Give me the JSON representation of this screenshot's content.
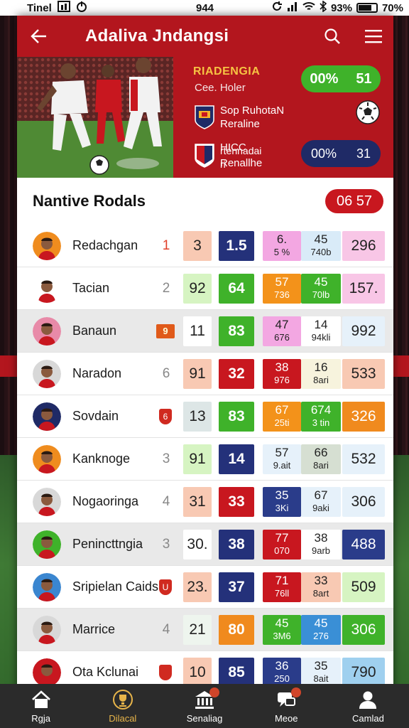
{
  "status_bar": {
    "carrier": "Tinel",
    "time": "944",
    "battery_left": "93%",
    "battery_right": "70%"
  },
  "header": {
    "title": "Adaliva Jndangsi"
  },
  "hero": {
    "label": "RIADENGIA",
    "sub": "Cee. Holer",
    "pill_green": {
      "left": "00%",
      "right": "51"
    },
    "team1": {
      "line1": "Sop RuhotaN",
      "line2": "Reraline"
    },
    "team2": {
      "line1": "HICC",
      "line1b": "rtennadai ri",
      "line2": "Renallhe"
    },
    "pill_navy": {
      "left": "00%",
      "right": "31"
    }
  },
  "section": {
    "title": "Nantive Rodals",
    "score": "06 57"
  },
  "rows": [
    {
      "name": "Redachgan",
      "rank": "1",
      "rank_style": "red",
      "c1": "3",
      "c1_color": "#f8c9b3",
      "c2": "1.5",
      "c2_color": "#24317a",
      "c3_t": "6.",
      "c3_b": "5 %",
      "c3_color": "#f3a7e2",
      "c4_t": "45",
      "c4_b": "740b",
      "c4_color": "#d9ebf8",
      "c5": "296",
      "c5_color": "#f8c6e6",
      "avatar_bg": "#ef8c1e",
      "alt": false
    },
    {
      "name": "Tacian",
      "rank": "2",
      "rank_style": "",
      "c1": "92",
      "c1_color": "#d6f4c2",
      "c2": "64",
      "c2_color": "#3fb22a",
      "c3_t": "57",
      "c3_b": "736",
      "c3_color": "#f3921a",
      "c4_t": "45",
      "c4_b": "70lb",
      "c4_color": "#3fb22a",
      "c5": "157.",
      "c5_color": "#f8c6e6",
      "avatar_bg": "#ffffff",
      "alt": false
    },
    {
      "name": "Banaun",
      "rank": "9",
      "rank_style": "badge",
      "c1": "11",
      "c1_color": "#ffffff",
      "c2": "83",
      "c2_color": "#3fb22a",
      "c3_t": "47",
      "c3_b": "676",
      "c3_color": "#f3a7e2",
      "c4_t": "14",
      "c4_b": "94kli",
      "c4_color": "#ffffff",
      "c5": "992",
      "c5_color": "#e6f1fa",
      "avatar_bg": "#e88aa8",
      "alt": true
    },
    {
      "name": "Naradon",
      "rank": "6",
      "rank_style": "",
      "c1": "91",
      "c1_color": "#f8c9b3",
      "c2": "32",
      "c2_color": "#c8171f",
      "c3_t": "38",
      "c3_b": "976",
      "c3_color": "#c8171f",
      "c4_t": "16",
      "c4_b": "8ari",
      "c4_color": "#f7f3dd",
      "c5": "533",
      "c5_color": "#f8c9b3",
      "avatar_bg": "#d8d8d8",
      "alt": false
    },
    {
      "name": "Sovdain",
      "rank": "6",
      "rank_style": "shield",
      "c1": "13",
      "c1_color": "#dde6e6",
      "c2": "83",
      "c2_color": "#3fb22a",
      "c3_t": "67",
      "c3_b": "25ti",
      "c3_color": "#f3921a",
      "c4_t": "674",
      "c4_b": "3 tin",
      "c4_color": "#3fb22a",
      "c5": "326",
      "c5_color": "#f08a1e",
      "avatar_bg": "#1f2a66",
      "alt": false
    },
    {
      "name": "Kanknoge",
      "rank": "3",
      "rank_style": "",
      "c1": "91",
      "c1_color": "#d6f4c2",
      "c2": "14",
      "c2_color": "#24317a",
      "c3_t": "57",
      "c3_b": "9.ait",
      "c3_color": "#e6f1fa",
      "c4_t": "66",
      "c4_b": "8ari",
      "c4_color": "#d6dfd2",
      "c5": "532",
      "c5_color": "#e6f1fa",
      "avatar_bg": "#ef8c1e",
      "alt": false
    },
    {
      "name": "Nogaoringa",
      "rank": "4",
      "rank_style": "",
      "c1": "31",
      "c1_color": "#f8c9b3",
      "c2": "33",
      "c2_color": "#c8171f",
      "c3_t": "35",
      "c3_b": "3Ki",
      "c3_color": "#2a3c8a",
      "c4_t": "67",
      "c4_b": "9aki",
      "c4_color": "#e6f1fa",
      "c5": "306",
      "c5_color": "#e6f1fa",
      "avatar_bg": "#d8d8d8",
      "alt": false
    },
    {
      "name": "Penincttngia",
      "rank": "3",
      "rank_style": "",
      "c1": "30.",
      "c1_color": "#ffffff",
      "c2": "38",
      "c2_color": "#24317a",
      "c3_t": "77",
      "c3_b": "070",
      "c3_color": "#c8171f",
      "c4_t": "38",
      "c4_b": "9arb",
      "c4_color": "#ffffff",
      "c5": "488",
      "c5_color": "#2a3c8a",
      "avatar_bg": "#3fb22a",
      "alt": true
    },
    {
      "name": "Sripielan Caids",
      "rank": "U",
      "rank_style": "shield",
      "c1": "23.",
      "c1_color": "#f8c9b3",
      "c2": "37",
      "c2_color": "#24317a",
      "c3_t": "71",
      "c3_b": "76ll",
      "c3_color": "#c8171f",
      "c4_t": "33",
      "c4_b": "8art",
      "c4_color": "#f8c9b3",
      "c5": "509",
      "c5_color": "#d6f4c2",
      "avatar_bg": "#3a86d0",
      "alt": false
    },
    {
      "name": "Marrice",
      "rank": "4",
      "rank_style": "",
      "c1": "21",
      "c1_color": "#eef5ee",
      "c2": "80",
      "c2_color": "#f08a1e",
      "c3_t": "45",
      "c3_b": "3M6",
      "c3_color": "#3fb22a",
      "c4_t": "45",
      "c4_b": "276",
      "c4_color": "#3a8fd6",
      "c5": "306",
      "c5_color": "#3fb22a",
      "avatar_bg": "#d8d8d8",
      "alt": true
    },
    {
      "name": "Ota Kclunai",
      "rank": "",
      "rank_style": "shield",
      "c1": "10",
      "c1_color": "#f8c9b3",
      "c2": "85",
      "c2_color": "#24317a",
      "c3_t": "36",
      "c3_b": "250",
      "c3_color": "#2a3c8a",
      "c4_t": "35",
      "c4_b": "8ait",
      "c4_color": "#e6f1fa",
      "c5": "790",
      "c5_color": "#9fd0ef",
      "avatar_bg": "#c8171f",
      "alt": false
    }
  ],
  "nav": [
    {
      "label": "Rgja",
      "icon": "home-icon",
      "active": false
    },
    {
      "label": "Dilacal",
      "icon": "trophy-icon",
      "active": true
    },
    {
      "label": "Senaliag",
      "icon": "bank-icon",
      "active": false
    },
    {
      "label": "Meoe",
      "icon": "chat-icon",
      "active": false
    },
    {
      "label": "Camlad",
      "icon": "profile-icon",
      "active": false
    }
  ],
  "colors": {
    "brand_red": "#b3161e",
    "navy": "#1f2a66",
    "green": "#3fb22a",
    "nav_bg": "#2b2b2b",
    "nav_active": "#e8b54a"
  }
}
